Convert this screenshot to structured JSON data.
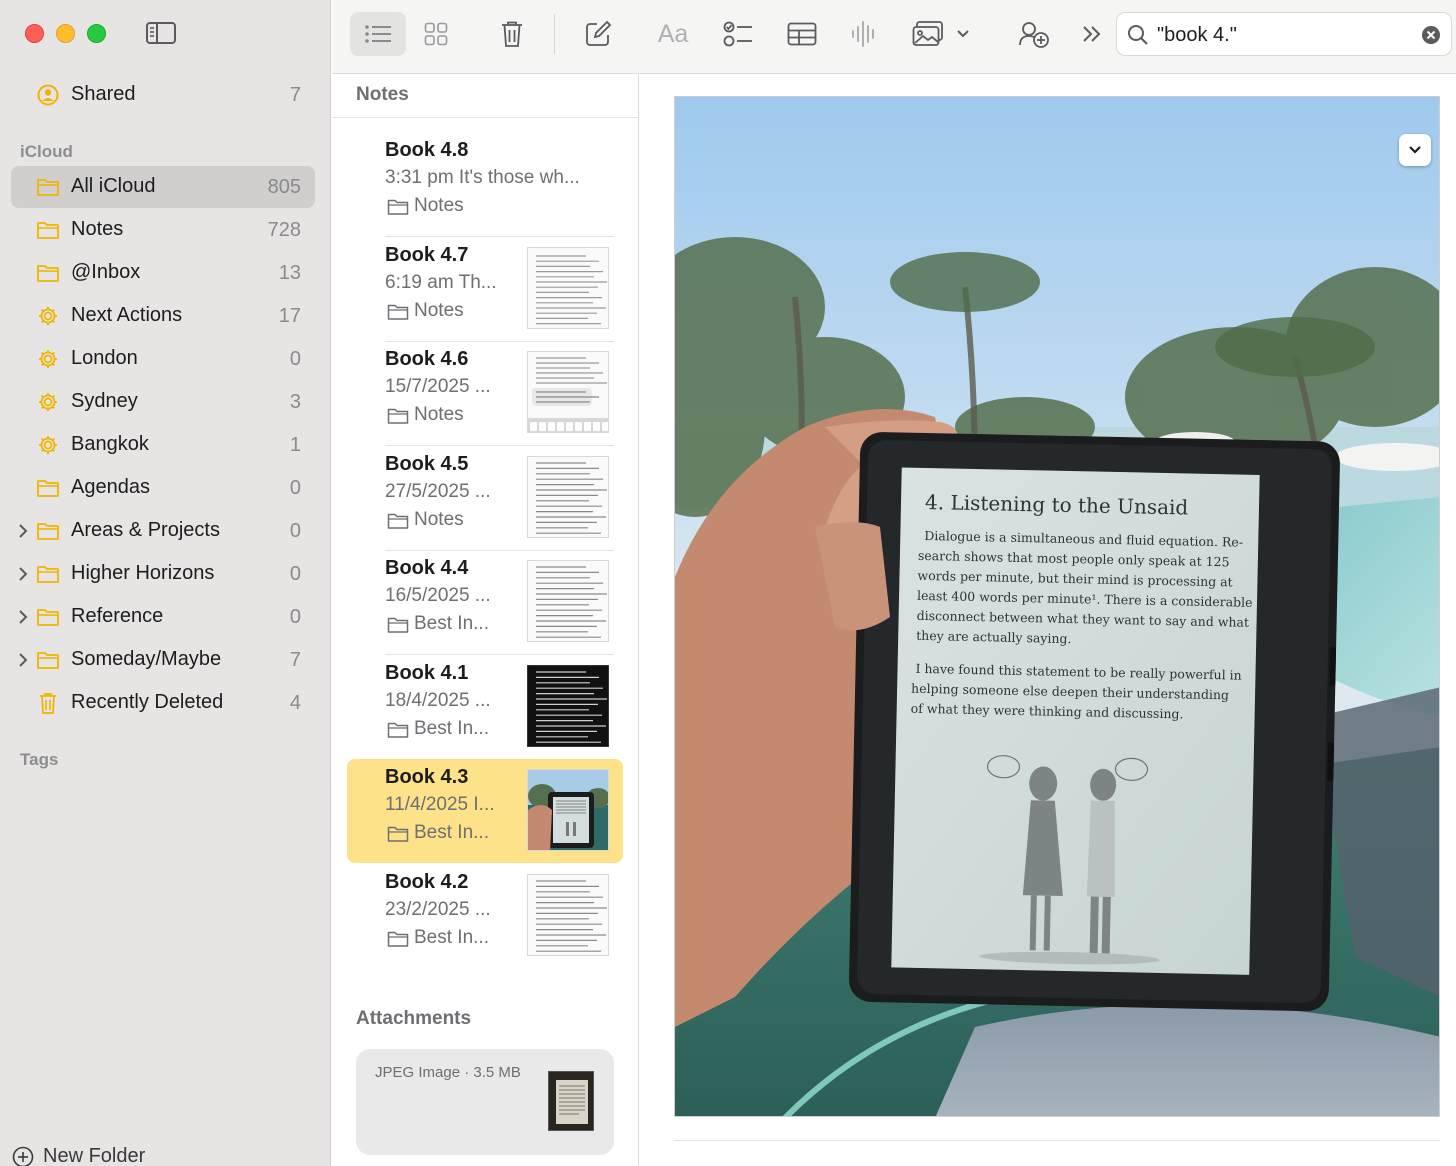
{
  "sidebar": {
    "shared": {
      "label": "Shared",
      "count": "7"
    },
    "section_icloud": "iCloud",
    "items": [
      {
        "label": "All iCloud",
        "count": "805",
        "icon": "folder-icon"
      },
      {
        "label": "Notes",
        "count": "728",
        "icon": "folder-icon"
      },
      {
        "label": "@Inbox",
        "count": "13",
        "icon": "folder-icon"
      },
      {
        "label": "Next Actions",
        "count": "17",
        "icon": "smart-folder-gear-icon"
      },
      {
        "label": "London",
        "count": "0",
        "icon": "smart-folder-gear-icon"
      },
      {
        "label": "Sydney",
        "count": "3",
        "icon": "smart-folder-gear-icon"
      },
      {
        "label": "Bangkok",
        "count": "1",
        "icon": "smart-folder-gear-icon"
      },
      {
        "label": "Agendas",
        "count": "0",
        "icon": "folder-icon"
      },
      {
        "label": "Areas & Projects",
        "count": "0",
        "icon": "folder-icon"
      },
      {
        "label": "Higher Horizons",
        "count": "0",
        "icon": "folder-icon"
      },
      {
        "label": "Reference",
        "count": "0",
        "icon": "folder-icon"
      },
      {
        "label": "Someday/Maybe",
        "count": "7",
        "icon": "folder-icon"
      },
      {
        "label": "Recently Deleted",
        "count": "4",
        "icon": "trash-icon"
      }
    ],
    "section_tags": "Tags",
    "new_folder": "New Folder"
  },
  "toolbar": {
    "format_label": "Aa",
    "search_value": "\"book 4.\""
  },
  "notelist": {
    "header": "Notes",
    "notes": [
      {
        "title": "Book 4.8",
        "meta": "3:31 pm  It's those wh...",
        "folder": "Notes"
      },
      {
        "title": "Book 4.7",
        "meta": "6:19 am  Th...",
        "folder": "Notes"
      },
      {
        "title": "Book 4.6",
        "meta": "15/7/2025  ...",
        "folder": "Notes"
      },
      {
        "title": "Book 4.5",
        "meta": "27/5/2025  ...",
        "folder": "Notes"
      },
      {
        "title": "Book 4.4",
        "meta": "16/5/2025  ...",
        "folder": "Best In..."
      },
      {
        "title": "Book 4.1",
        "meta": "18/4/2025  ...",
        "folder": "Best In..."
      },
      {
        "title": "Book 4.3",
        "meta": "11/4/2025  I...",
        "folder": "Best In..."
      },
      {
        "title": "Book 4.2",
        "meta": "23/2/2025  ...",
        "folder": "Best In..."
      }
    ],
    "attachments_header": "Attachments",
    "attachment_label": "JPEG Image · 3.5 MB"
  },
  "photo": {
    "chapter_title": "4. Listening to the Unsaid",
    "paragraph1": [
      "Dialogue is a simultaneous and fluid equation. Re-",
      "search shows that most people only speak at 125",
      "words per minute, but their mind is processing at",
      "least 400 words per minute¹. There is a considerable",
      "disconnect between what they want to say and what",
      "they are actually saying."
    ],
    "paragraph2": [
      "I have found this statement to be really powerful in",
      "helping someone else deepen their understanding",
      "of what they were thinking and discussing."
    ]
  },
  "colors": {
    "accent": "#f0b400",
    "selected_note": "#fde28a",
    "sidebar_bg": "#e6e5e3"
  }
}
